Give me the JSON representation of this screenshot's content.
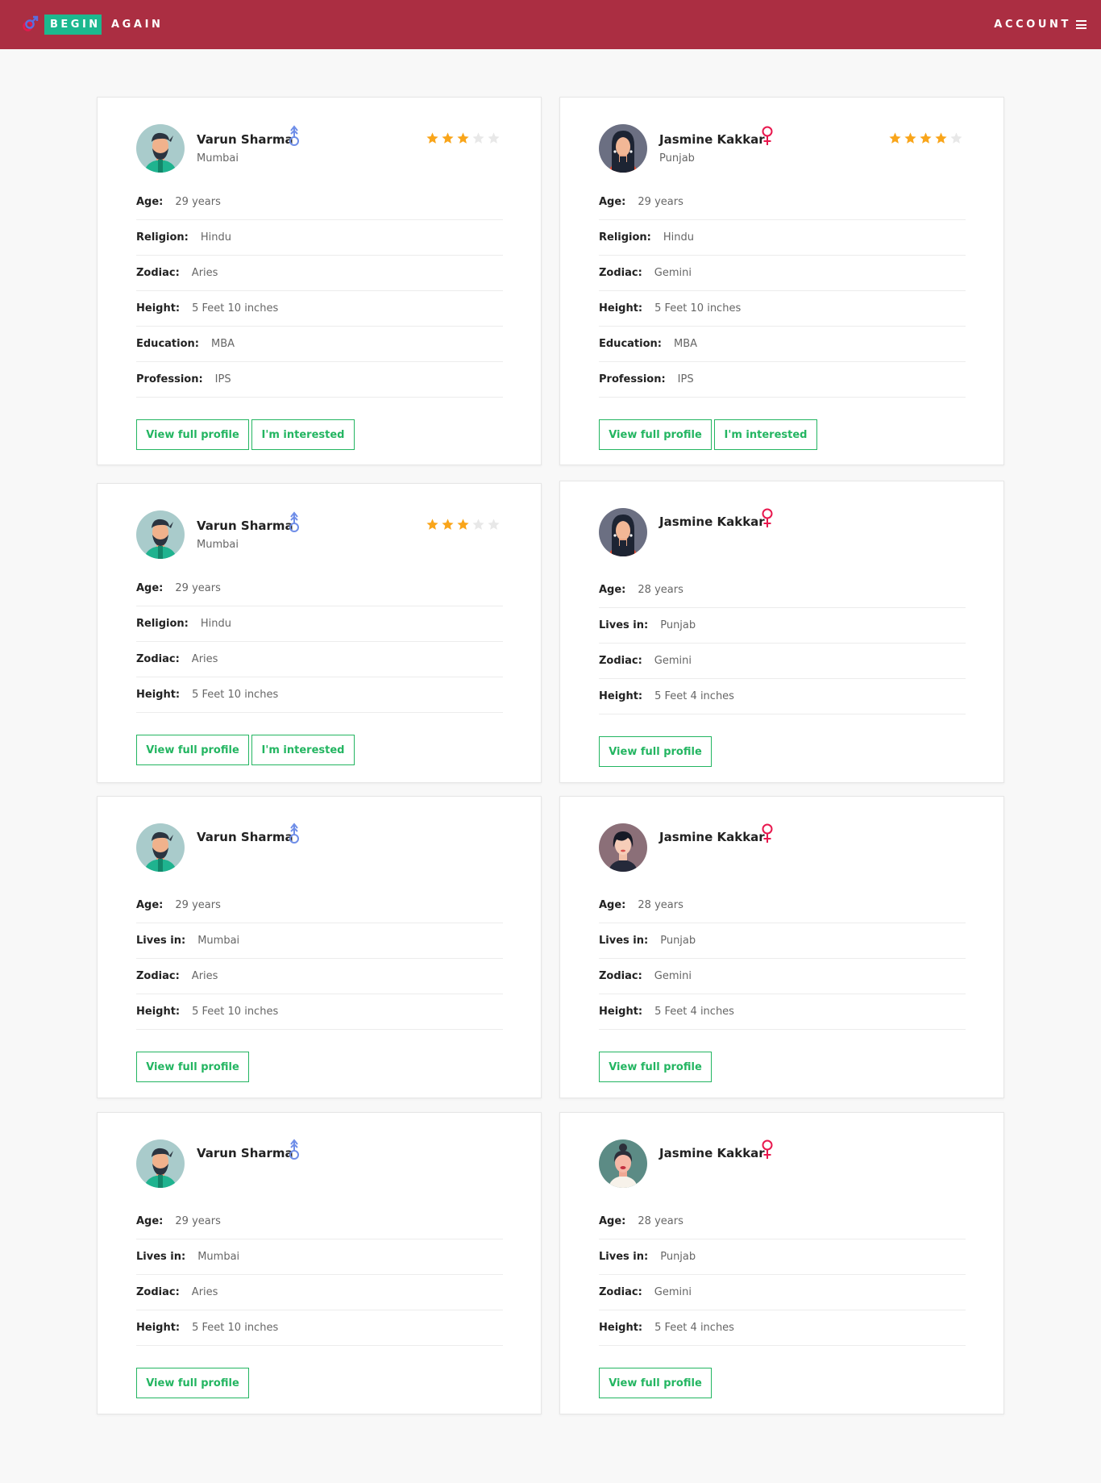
{
  "brand": {
    "begin": "BEGIN",
    "again": "AGAIN"
  },
  "nav": {
    "account_label": "ACCOUNT"
  },
  "colors": {
    "navbar": "#ab2e42",
    "brand_badge": "#1cb88f",
    "button_green": "#23b561",
    "star": "#f9a51a",
    "male": "#6f8ee8",
    "female": "#e8174d"
  },
  "labels": {
    "age": "Age:",
    "religion": "Religion:",
    "zodiac": "Zodiac:",
    "height": "Height:",
    "education": "Education:",
    "profession": "Profession:",
    "lives_in": "Lives in:",
    "view_full_profile": "View full profile",
    "interested": "I'm interested"
  },
  "cards": [
    {
      "name": "Varun Sharma",
      "gender": "male",
      "location": "Mumbai",
      "rating": 3,
      "rating_max": 5,
      "avatar": "man-beard",
      "rows": [
        {
          "label": "Age:",
          "value": "29 years"
        },
        {
          "label": "Religion:",
          "value": "Hindu"
        },
        {
          "label": "Zodiac:",
          "value": "Aries"
        },
        {
          "label": "Height:",
          "value": "5 Feet 10 inches"
        },
        {
          "label": "Education:",
          "value": "MBA"
        },
        {
          "label": "Profession:",
          "value": "IPS"
        }
      ],
      "buttons": [
        "View full profile",
        "I'm interested"
      ]
    },
    {
      "name": "Jasmine Kakkar",
      "gender": "female",
      "location": "Punjab",
      "rating": 4,
      "rating_max": 5,
      "avatar": "woman-long-hair",
      "rows": [
        {
          "label": "Age:",
          "value": "29 years"
        },
        {
          "label": "Religion:",
          "value": "Hindu"
        },
        {
          "label": "Zodiac:",
          "value": "Gemini"
        },
        {
          "label": "Height:",
          "value": "5 Feet 10 inches"
        },
        {
          "label": "Education:",
          "value": "MBA"
        },
        {
          "label": "Profession:",
          "value": "IPS"
        }
      ],
      "buttons": [
        "View full profile",
        "I'm interested"
      ]
    },
    {
      "name": "Varun Sharma",
      "gender": "male",
      "location": "Mumbai",
      "rating": 3,
      "rating_max": 5,
      "avatar": "man-beard",
      "rows": [
        {
          "label": "Age:",
          "value": "29 years"
        },
        {
          "label": "Religion:",
          "value": "Hindu"
        },
        {
          "label": "Zodiac:",
          "value": "Aries"
        },
        {
          "label": "Height:",
          "value": "5 Feet 10 inches"
        }
      ],
      "buttons": [
        "View full profile",
        "I'm interested"
      ]
    },
    {
      "name": "Jasmine Kakkar",
      "gender": "female",
      "location": "",
      "rating": 0,
      "rating_max": 0,
      "avatar": "woman-long-hair",
      "rows": [
        {
          "label": "Age:",
          "value": "28 years"
        },
        {
          "label": "Lives in:",
          "value": "Punjab"
        },
        {
          "label": "Zodiac:",
          "value": "Gemini"
        },
        {
          "label": "Height:",
          "value": "5 Feet 4 inches"
        }
      ],
      "buttons": [
        "View full profile"
      ]
    },
    {
      "name": "Varun Sharma",
      "gender": "male",
      "location": "",
      "rating": 0,
      "rating_max": 0,
      "avatar": "man-beard",
      "rows": [
        {
          "label": "Age:",
          "value": "29 years"
        },
        {
          "label": "Lives in:",
          "value": "Mumbai"
        },
        {
          "label": "Zodiac:",
          "value": "Aries"
        },
        {
          "label": "Height:",
          "value": "5 Feet 10 inches"
        }
      ],
      "buttons": [
        "View full profile"
      ]
    },
    {
      "name": "Jasmine Kakkar",
      "gender": "female",
      "location": "",
      "rating": 0,
      "rating_max": 0,
      "avatar": "person-bob-hair",
      "rows": [
        {
          "label": "Age:",
          "value": "28 years"
        },
        {
          "label": "Lives in:",
          "value": "Punjab"
        },
        {
          "label": "Zodiac:",
          "value": "Gemini"
        },
        {
          "label": "Height:",
          "value": "5 Feet 4 inches"
        }
      ],
      "buttons": [
        "View full profile"
      ]
    },
    {
      "name": "Varun Sharma",
      "gender": "male",
      "location": "",
      "rating": 0,
      "rating_max": 0,
      "avatar": "man-beard",
      "rows": [
        {
          "label": "Age:",
          "value": "29 years"
        },
        {
          "label": "Lives in:",
          "value": "Mumbai"
        },
        {
          "label": "Zodiac:",
          "value": "Aries"
        },
        {
          "label": "Height:",
          "value": "5 Feet 10 inches"
        }
      ],
      "buttons": [
        "View full profile"
      ]
    },
    {
      "name": "Jasmine Kakkar",
      "gender": "female",
      "location": "",
      "rating": 0,
      "rating_max": 0,
      "avatar": "woman-bun-hair",
      "rows": [
        {
          "label": "Age:",
          "value": "28 years"
        },
        {
          "label": "Lives in:",
          "value": "Punjab"
        },
        {
          "label": "Zodiac:",
          "value": "Gemini"
        },
        {
          "label": "Height:",
          "value": "5 Feet 4 inches"
        }
      ],
      "buttons": [
        "View full profile"
      ]
    }
  ]
}
